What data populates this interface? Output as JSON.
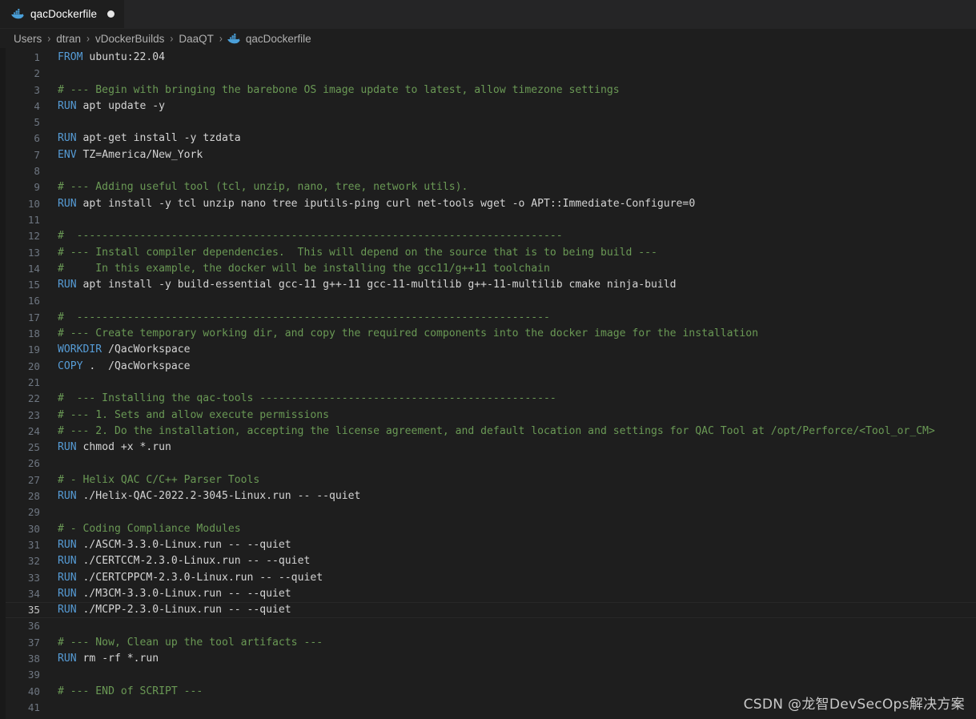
{
  "window": {
    "tab": {
      "label": "qacDockerfile",
      "icon": "docker-whale-icon",
      "dirty": true
    }
  },
  "breadcrumb": {
    "separator": "›",
    "items": [
      "Users",
      "dtran",
      "vDockerBuilds",
      "DaaQT"
    ],
    "file": "qacDockerfile",
    "file_icon": "docker-whale-icon"
  },
  "editor": {
    "language": "dockerfile",
    "active_line": 35,
    "total_visible_lines": 41,
    "colors": {
      "background": "#1e1e1e",
      "keyword": "#569cd6",
      "comment": "#6a9955",
      "text": "#d4d4d4",
      "line_number": "#6e7681",
      "tab_bar": "#252526"
    },
    "lines": [
      {
        "n": 1,
        "kw": "FROM",
        "rest": " ubuntu:22.04"
      },
      {
        "n": 2,
        "kw": "",
        "rest": ""
      },
      {
        "n": 3,
        "comment": "# --- Begin with bringing the barebone OS image update to latest, allow timezone settings"
      },
      {
        "n": 4,
        "kw": "RUN",
        "rest": " apt update -y"
      },
      {
        "n": 5,
        "kw": "",
        "rest": ""
      },
      {
        "n": 6,
        "kw": "RUN",
        "rest": " apt-get install -y tzdata"
      },
      {
        "n": 7,
        "kw": "ENV",
        "rest": " TZ=America/New_York"
      },
      {
        "n": 8,
        "kw": "",
        "rest": ""
      },
      {
        "n": 9,
        "comment": "# --- Adding useful tool (tcl, unzip, nano, tree, network utils)."
      },
      {
        "n": 10,
        "kw": "RUN",
        "rest": " apt install -y tcl unzip nano tree iputils-ping curl net-tools wget -o APT::Immediate-Configure=0"
      },
      {
        "n": 11,
        "kw": "",
        "rest": ""
      },
      {
        "n": 12,
        "comment": "#  -----------------------------------------------------------------------------"
      },
      {
        "n": 13,
        "comment": "# --- Install compiler dependencies.  This will depend on the source that is to being build ---"
      },
      {
        "n": 14,
        "comment": "#     In this example, the docker will be installing the gcc11/g++11 toolchain"
      },
      {
        "n": 15,
        "kw": "RUN",
        "rest": " apt install -y build-essential gcc-11 g++-11 gcc-11-multilib g++-11-multilib cmake ninja-build"
      },
      {
        "n": 16,
        "kw": "",
        "rest": ""
      },
      {
        "n": 17,
        "comment": "#  ---------------------------------------------------------------------------"
      },
      {
        "n": 18,
        "comment": "# --- Create temporary working dir, and copy the required components into the docker image for the installation"
      },
      {
        "n": 19,
        "kw": "WORKDIR",
        "rest": " /QacWorkspace"
      },
      {
        "n": 20,
        "kw": "COPY",
        "rest": " .  /QacWorkspace"
      },
      {
        "n": 21,
        "kw": "",
        "rest": ""
      },
      {
        "n": 22,
        "comment": "#  --- Installing the qac-tools -----------------------------------------------"
      },
      {
        "n": 23,
        "comment": "# --- 1. Sets and allow execute permissions"
      },
      {
        "n": 24,
        "comment": "# --- 2. Do the installation, accepting the license agreement, and default location and settings for QAC Tool at /opt/Perforce/<Tool_or_CM>"
      },
      {
        "n": 25,
        "kw": "RUN",
        "rest": " chmod +x *.run"
      },
      {
        "n": 26,
        "kw": "",
        "rest": ""
      },
      {
        "n": 27,
        "comment": "# - Helix QAC C/C++ Parser Tools"
      },
      {
        "n": 28,
        "kw": "RUN",
        "rest": " ./Helix-QAC-2022.2-3045-Linux.run -- --quiet"
      },
      {
        "n": 29,
        "kw": "",
        "rest": ""
      },
      {
        "n": 30,
        "comment": "# - Coding Compliance Modules"
      },
      {
        "n": 31,
        "kw": "RUN",
        "rest": " ./ASCM-3.3.0-Linux.run -- --quiet"
      },
      {
        "n": 32,
        "kw": "RUN",
        "rest": " ./CERTCCM-2.3.0-Linux.run -- --quiet"
      },
      {
        "n": 33,
        "kw": "RUN",
        "rest": " ./CERTCPPCM-2.3.0-Linux.run -- --quiet"
      },
      {
        "n": 34,
        "kw": "RUN",
        "rest": " ./M3CM-3.3.0-Linux.run -- --quiet"
      },
      {
        "n": 35,
        "kw": "RUN",
        "rest": " ./MCPP-2.3.0-Linux.run -- --quiet"
      },
      {
        "n": 36,
        "kw": "",
        "rest": ""
      },
      {
        "n": 37,
        "comment": "# --- Now, Clean up the tool artifacts ---"
      },
      {
        "n": 38,
        "kw": "RUN",
        "rest": " rm -rf *.run"
      },
      {
        "n": 39,
        "kw": "",
        "rest": ""
      },
      {
        "n": 40,
        "comment": "# --- END of SCRIPT ---"
      },
      {
        "n": 41,
        "kw": "",
        "rest": ""
      }
    ]
  },
  "watermark": {
    "text": "CSDN @龙智DevSecOps解决方案"
  }
}
